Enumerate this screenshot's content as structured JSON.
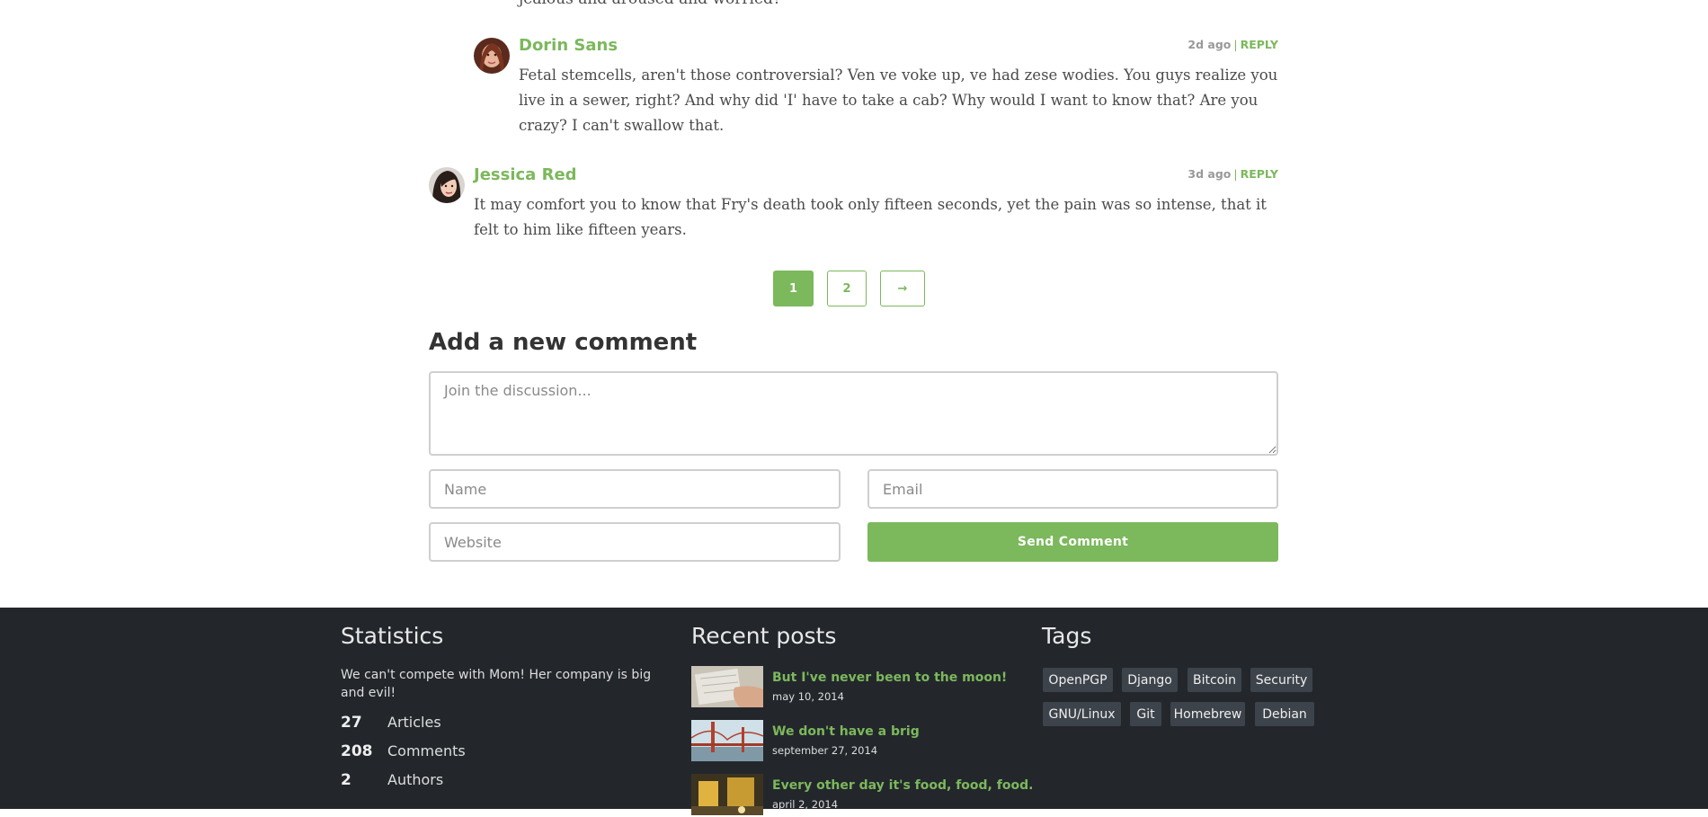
{
  "comments": {
    "truncated_text": "jealous and aroused and worried?",
    "items": [
      {
        "author": "Dorin Sans",
        "time": "2d ago",
        "separator": "|",
        "reply": "REPLY",
        "text": "Fetal stemcells, aren't those controversial? Ven ve voke up, ve had zese wodies. You guys realize you live in a sewer, right? And why did 'I' have to take a cab? Why would I want to know that? Are you crazy? I can't swallow that."
      },
      {
        "author": "Jessica Red",
        "time": "3d ago",
        "separator": "|",
        "reply": "REPLY",
        "text": "It may comfort you to know that Fry's death took only fifteen seconds, yet the pain was so intense, that it felt to him like fifteen years."
      }
    ]
  },
  "pagination": {
    "pages": [
      "1",
      "2"
    ],
    "current": "1",
    "next_icon": "arrow-right-icon",
    "next_glyph": "→"
  },
  "comment_form": {
    "title": "Add a new comment",
    "message_placeholder": "Join the discussion...",
    "name_placeholder": "Name",
    "email_placeholder": "Email",
    "website_placeholder": "Website",
    "submit_label": "Send Comment"
  },
  "footer": {
    "statistics": {
      "title": "Statistics",
      "description": "We can't compete with Mom! Her company is big and evil!",
      "items": [
        {
          "value": "27",
          "label": "Articles"
        },
        {
          "value": "208",
          "label": "Comments"
        },
        {
          "value": "2",
          "label": "Authors"
        }
      ]
    },
    "recent_posts": {
      "title": "Recent posts",
      "items": [
        {
          "title": "But I've never been to the moon!",
          "date": "may 10, 2014"
        },
        {
          "title": "We don't have a brig",
          "date": "september 27, 2014"
        },
        {
          "title": "Every other day it's food, food, food.",
          "date": "april 2, 2014"
        }
      ]
    },
    "tags": {
      "title": "Tags",
      "items": [
        "OpenPGP",
        "Django",
        "Bitcoin",
        "Security",
        "GNU/Linux",
        "Git",
        "Homebrew",
        "Debian"
      ]
    }
  },
  "colors": {
    "accent": "#7cb85c",
    "footer_bg": "#23272c",
    "tag_bg": "#3d434b"
  }
}
